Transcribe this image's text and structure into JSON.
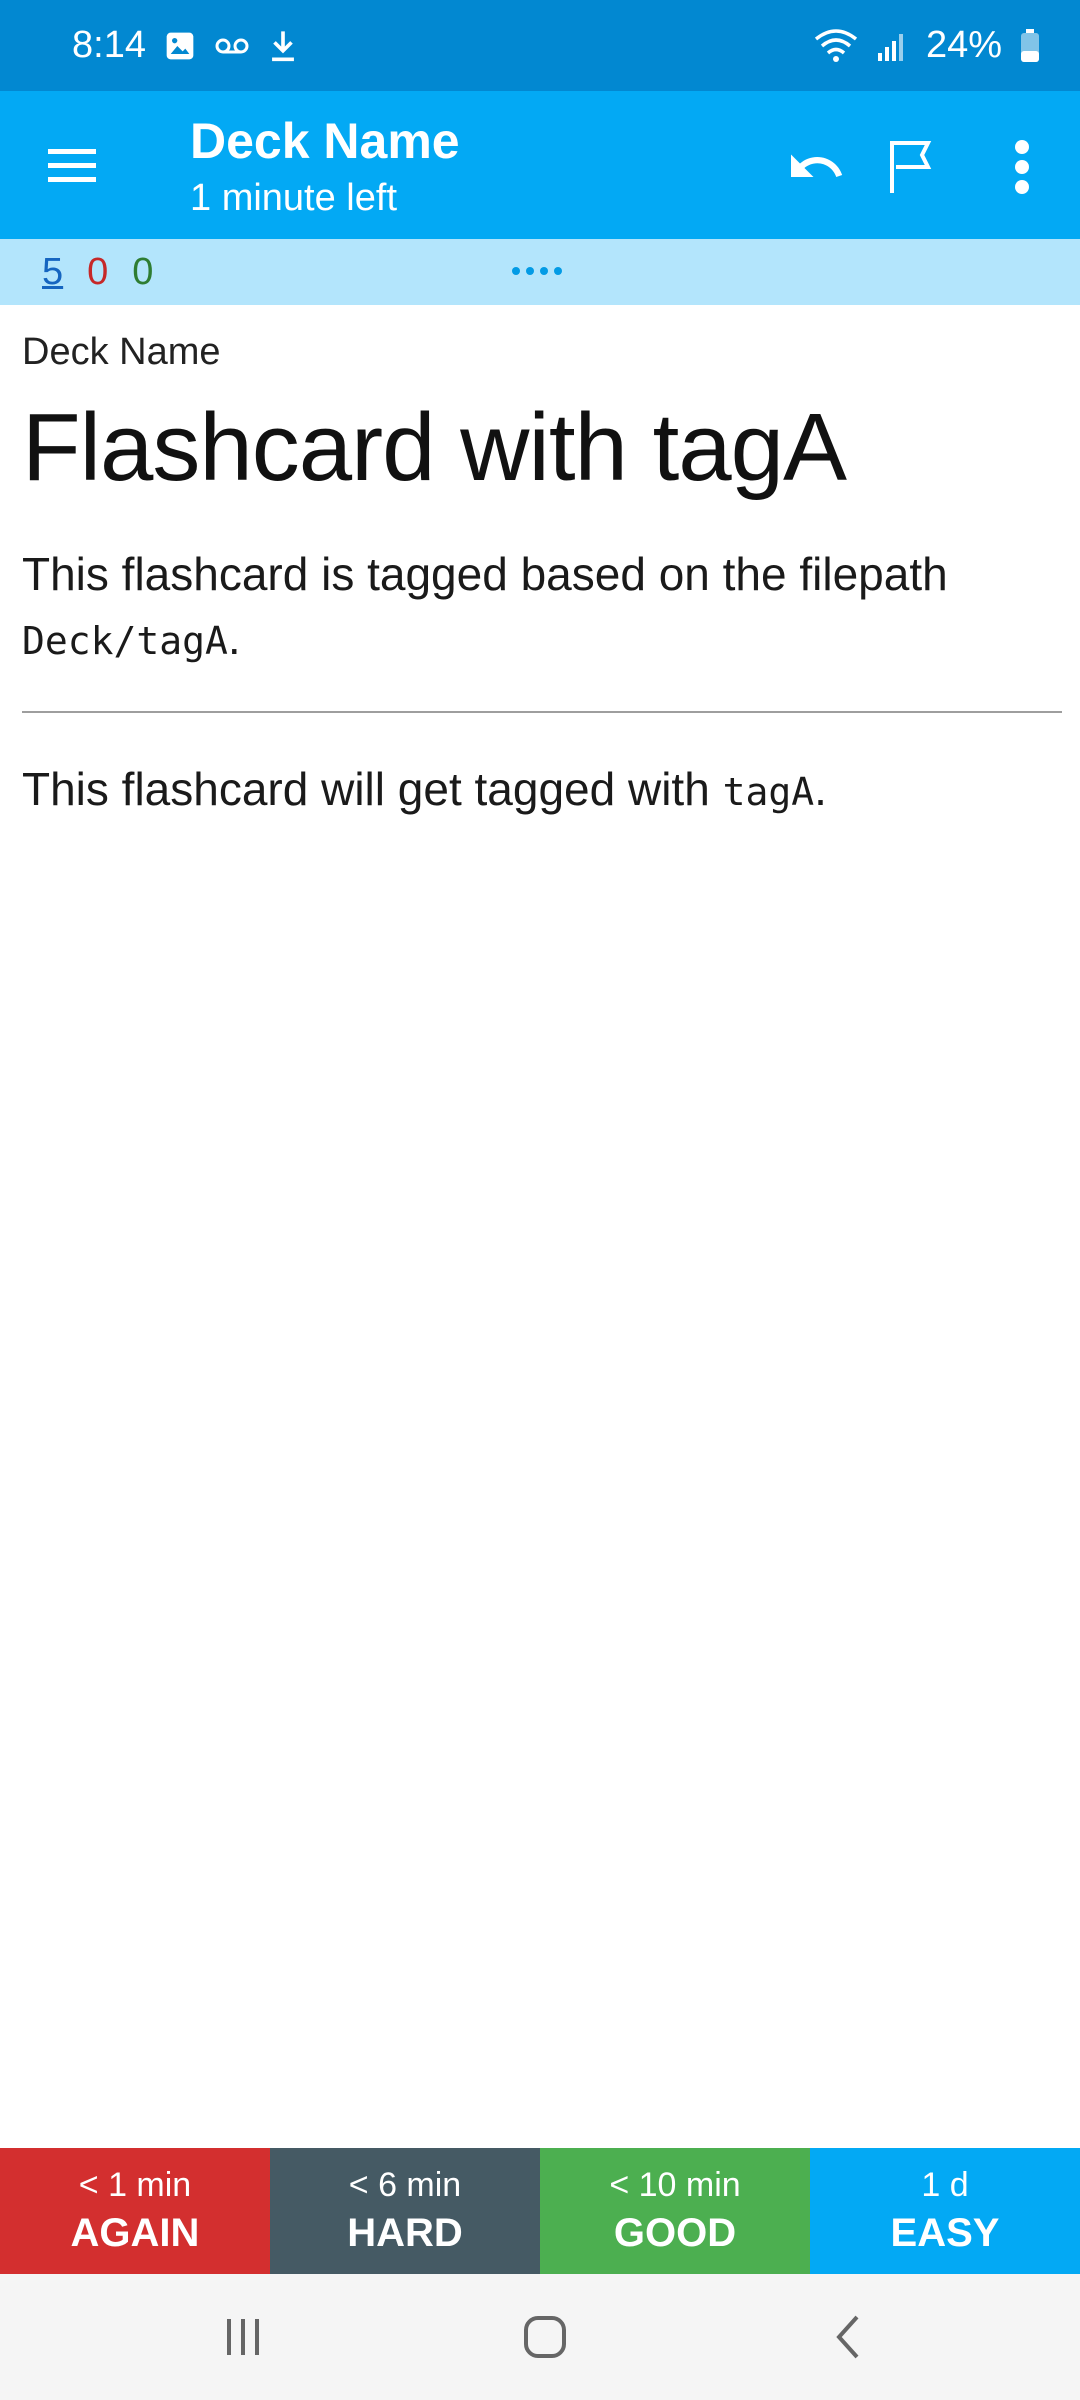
{
  "status_bar": {
    "time": "8:14",
    "battery": "24%",
    "icons": [
      "image-icon",
      "voicemail-icon",
      "download-icon",
      "wifi-icon",
      "signal-icon",
      "battery-icon"
    ]
  },
  "app_bar": {
    "title": "Deck Name",
    "subtitle": "1 minute left",
    "icons": [
      "menu-icon",
      "undo-icon",
      "flag-icon",
      "more-vert-icon"
    ]
  },
  "counts": {
    "new": "5",
    "learning": "0",
    "review": "0"
  },
  "card": {
    "deck_label": "Deck Name",
    "heading": "Flashcard with tagA",
    "question_text_pre": "This flashcard is tagged based on the filepath ",
    "question_code": "Deck/tagA",
    "question_text_post": ".",
    "answer_text_pre": "This flashcard will get tagged with ",
    "answer_code": "tagA",
    "answer_text_post": "."
  },
  "answer_buttons": [
    {
      "time": "< 1 min",
      "label": "AGAIN"
    },
    {
      "time": "< 6 min",
      "label": "HARD"
    },
    {
      "time": "< 10 min",
      "label": "GOOD"
    },
    {
      "time": "1 d",
      "label": "EASY"
    }
  ],
  "colors": {
    "status_bar": "#0288d1",
    "app_bar": "#03a9f4",
    "counts_bar": "#b3e5fc",
    "again": "#d32f2f",
    "hard": "#455a64",
    "good": "#4caf50",
    "easy": "#03a9f4"
  },
  "nav_bar": {
    "icons": [
      "recents-icon",
      "home-icon",
      "back-icon"
    ]
  }
}
